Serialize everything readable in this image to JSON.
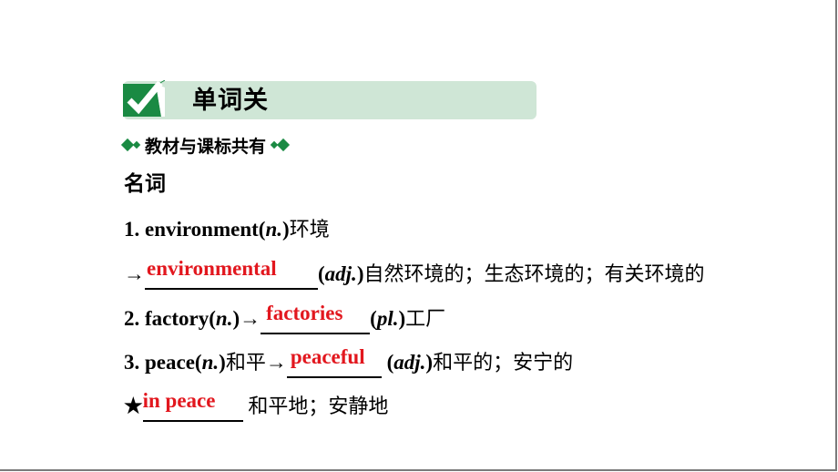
{
  "section": {
    "icon": "checkmark-icon",
    "title": "单词关",
    "accent_color": "#1a8a43",
    "bar_color": "#cfe6d6"
  },
  "subheading": {
    "text": "教材与课标共有",
    "left_icon": "diamond-icon",
    "right_icon": "diamond-icon"
  },
  "category": "名词",
  "entries": [
    {
      "number": "1.",
      "word": "environment",
      "pos": "n.",
      "meaning": "环境"
    },
    {
      "arrow": "→",
      "answer": "environmental",
      "pos": "adj.",
      "meaning": "自然环境的；生态环境的；有关环境的"
    },
    {
      "number": "2.",
      "word": "factory",
      "pos": "n.",
      "arrow": "→",
      "answer": "factories",
      "pos2": "pl.",
      "meaning": "工厂"
    },
    {
      "number": "3.",
      "word": "peace",
      "pos": "n.",
      "meaning": "和平",
      "arrow": "→",
      "answer": "peaceful",
      "pos2": "adj.",
      "meaning2": "和平的；安宁的"
    },
    {
      "star": "★",
      "answer": "in peace",
      "meaning": "和平地；安静地"
    }
  ],
  "answer_color": "#e2171e"
}
